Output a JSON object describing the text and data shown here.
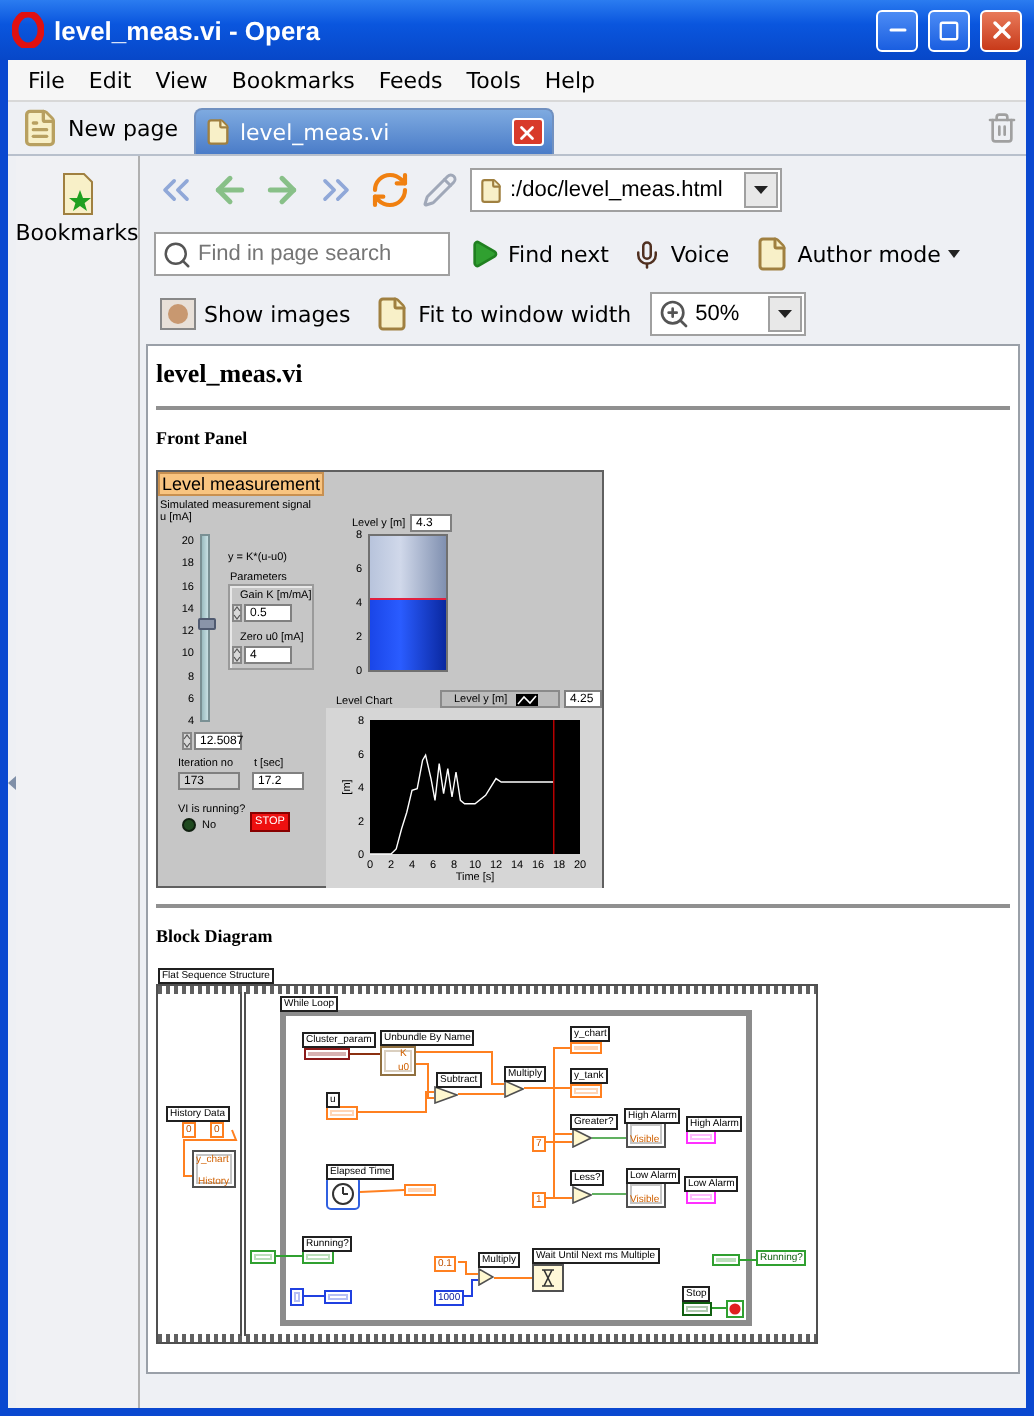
{
  "window": {
    "title": "level_meas.vi - Opera"
  },
  "menu": [
    {
      "label": "File"
    },
    {
      "label": "Edit"
    },
    {
      "label": "View"
    },
    {
      "label": "Bookmarks"
    },
    {
      "label": "Feeds"
    },
    {
      "label": "Tools"
    },
    {
      "label": "Help"
    }
  ],
  "new_page_button": "New page",
  "tabs": [
    {
      "label": "level_meas.vi",
      "selected": true
    }
  ],
  "sidebar": {
    "items": [
      {
        "label": "Bookmarks"
      }
    ]
  },
  "address": {
    "value": ":/doc/level_meas.html"
  },
  "find": {
    "placeholder": "Find in page search",
    "find_next": "Find next",
    "voice": "Voice",
    "author_mode": "Author mode"
  },
  "view": {
    "show_images": "Show images",
    "fit": "Fit to window width",
    "zoom": "50%"
  },
  "page": {
    "heading": "level_meas.vi",
    "sections": [
      "Front Panel",
      "Block Diagram"
    ]
  },
  "front_panel": {
    "title": "Level measurement",
    "signal_label": "Simulated measurement signal",
    "signal_unit": "u [mA]",
    "slider": {
      "ticks": [
        "20",
        "18",
        "16",
        "14",
        "12",
        "10",
        "8",
        "6",
        "4"
      ],
      "level": 0.53,
      "reading": "12.5087"
    },
    "formula": "y = K*(u-u0)",
    "parameters": {
      "title": "Parameters",
      "gain_label": "Gain K [m/mA]",
      "gain_value": "0.5",
      "zero_label": "Zero u0 [mA]",
      "zero_value": "4"
    },
    "tank": {
      "label": "Level y [m]",
      "reading": "4.3",
      "ticks": [
        "8",
        "6",
        "4",
        "2",
        "0"
      ],
      "level": 0.54
    },
    "chart": {
      "label": "Level Chart",
      "reading": "4.25",
      "chart_data": {
        "type": "line",
        "xlabel": "Time [s]",
        "ylabel": "[m]",
        "xlim": [
          0,
          20
        ],
        "ylim": [
          0,
          8
        ],
        "xticks": [
          0,
          2,
          4,
          6,
          8,
          10,
          12,
          14,
          16,
          18,
          20
        ],
        "ref_lines": [
          {
            "axis": "x",
            "value": 17.5,
            "color": "#c00000"
          }
        ],
        "yticks": [
          0,
          2,
          4,
          6,
          8
        ],
        "x": [
          0,
          2,
          2.5,
          3,
          3.5,
          4,
          4.5,
          5,
          5.3,
          5.8,
          6.2,
          6.6,
          7,
          7.4,
          7.8,
          8.2,
          8.6,
          9,
          10,
          11,
          12,
          12.5,
          13,
          17.5
        ],
        "series": [
          {
            "name": "Level y [m]",
            "color": "#ffffff",
            "values": [
              0,
              0,
              0.3,
              1.5,
              2.5,
              3.8,
              3.9,
              5.6,
              5.9,
              4.5,
              3.2,
              5.4,
              3.6,
              5.1,
              3.4,
              4.9,
              3.2,
              3,
              3,
              3.5,
              4.5,
              4.3,
              4.3,
              4.3
            ]
          }
        ]
      }
    },
    "iteration": {
      "label": "Iteration no",
      "value": "173"
    },
    "time": {
      "label": "t [sec]",
      "value": "17.2"
    },
    "running": {
      "label": "VI is running?",
      "on": false,
      "status": "No"
    },
    "stop_button": "STOP"
  },
  "block_diagram": {
    "items": [
      {
        "kind": "label",
        "text": "Flat Sequence Structure"
      },
      {
        "kind": "label",
        "text": "While Loop"
      },
      {
        "kind": "label",
        "text": "Cluster_param"
      },
      {
        "kind": "label",
        "text": "Unbundle By Name"
      },
      {
        "kind": "node_text",
        "text": "K"
      },
      {
        "kind": "node_text",
        "text": "u0"
      },
      {
        "kind": "label",
        "text": "y_chart"
      },
      {
        "kind": "label",
        "text": "Subtract"
      },
      {
        "kind": "label",
        "text": "Multiply"
      },
      {
        "kind": "label",
        "text": "u"
      },
      {
        "kind": "label",
        "text": "y_tank"
      },
      {
        "kind": "label",
        "text": "History Data"
      },
      {
        "kind": "constant",
        "text": "0"
      },
      {
        "kind": "constant",
        "text": "0"
      },
      {
        "kind": "node_text",
        "text": "y_chart"
      },
      {
        "kind": "node_text",
        "text": "History"
      },
      {
        "kind": "label",
        "text": "Greater?"
      },
      {
        "kind": "constant",
        "text": "7"
      },
      {
        "kind": "label",
        "text": "High Alarm"
      },
      {
        "kind": "node_text",
        "text": "Visible"
      },
      {
        "kind": "label",
        "text": "High Alarm"
      },
      {
        "kind": "label",
        "text": "Elapsed Time"
      },
      {
        "kind": "label",
        "text": "Less?"
      },
      {
        "kind": "constant",
        "text": "1"
      },
      {
        "kind": "label",
        "text": "Low Alarm"
      },
      {
        "kind": "node_text",
        "text": "Visible"
      },
      {
        "kind": "label",
        "text": "Low Alarm"
      },
      {
        "kind": "label",
        "text": "Running?"
      },
      {
        "kind": "constant",
        "text": "0.1"
      },
      {
        "kind": "label",
        "text": "Multiply"
      },
      {
        "kind": "label",
        "text": "Wait Until Next ms Multiple"
      },
      {
        "kind": "indicator",
        "text": "Running?"
      },
      {
        "kind": "constant_int",
        "text": "1000"
      },
      {
        "kind": "label",
        "text": "Stop"
      }
    ]
  }
}
